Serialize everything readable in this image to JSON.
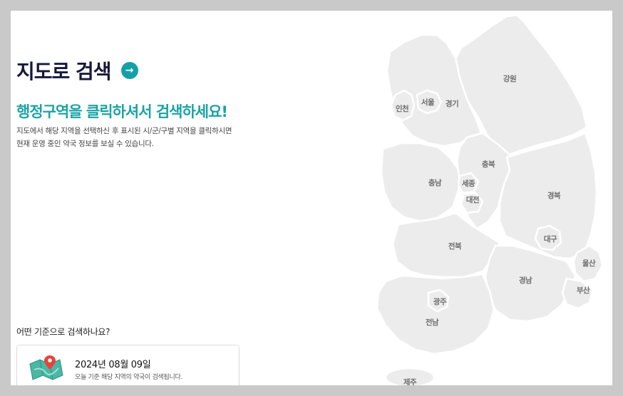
{
  "header": {
    "title": "지도로 검색",
    "arrow_icon": "arrow-right-icon",
    "subtitle": "행정구역을 클릭하셔서 검색하세요!",
    "description_line1": "지도에서 해당 지역을 선택하신 후 표시된 시/군/구별 지역을 클릭하시면",
    "description_line2": "현재 운영 중인 약국 정보를 보실 수 있습니다."
  },
  "criteria": {
    "label": "어떤 기준으로 검색하나요?",
    "date": "2024년 08월 09일",
    "note": "오늘 기준 해당 지역의 약국이 검색됩니다.",
    "icon": "map-pin-icon"
  },
  "map": {
    "regions": {
      "gangwon": "강원",
      "gyeonggi": "경기",
      "seoul": "서울",
      "incheon": "인천",
      "chungbuk": "충북",
      "chungnam": "충남",
      "sejong": "세종",
      "daejeon": "대전",
      "gyeongbuk": "경북",
      "daegu": "대구",
      "jeonbuk": "전북",
      "ulsan": "울산",
      "gyeongnam": "경남",
      "busan": "부산",
      "gwangju": "광주",
      "jeonnam": "전남",
      "jeju": "제주"
    }
  },
  "colors": {
    "title": "#16193a",
    "accent": "#1aa3a6",
    "map_fill": "#ececec",
    "map_label": "#6e6e6e"
  }
}
